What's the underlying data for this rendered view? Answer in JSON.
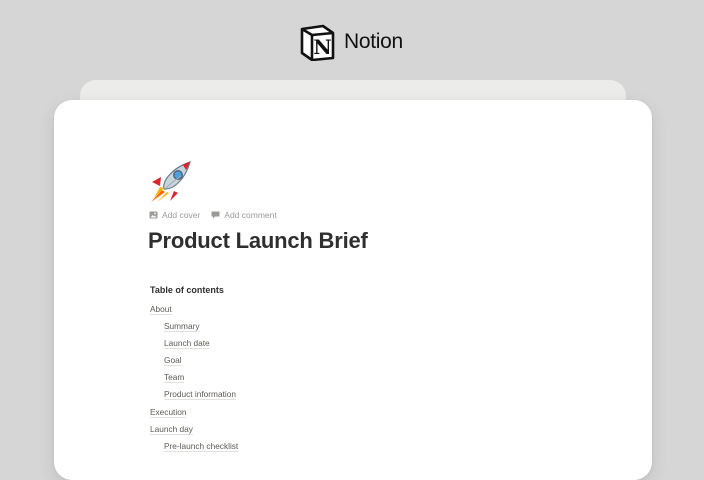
{
  "brand": {
    "name": "Notion",
    "icon": "notion-logo-icon"
  },
  "page": {
    "icon": "rocket-emoji-icon",
    "actions": [
      {
        "label": "Add cover",
        "icon": "image-icon"
      },
      {
        "label": "Add comment",
        "icon": "comment-icon"
      }
    ],
    "title": "Product Launch Brief"
  },
  "toc": {
    "heading": "Table of contents",
    "items": [
      {
        "label": "About",
        "level": 1
      },
      {
        "label": "Summary",
        "level": 2
      },
      {
        "label": "Launch date",
        "level": 2
      },
      {
        "label": "Goal",
        "level": 2
      },
      {
        "label": "Team",
        "level": 2
      },
      {
        "label": "Product information",
        "level": 2
      },
      {
        "label": "Execution",
        "level": 1
      },
      {
        "label": "Launch day",
        "level": 1
      },
      {
        "label": "Pre-launch checklist",
        "level": 2
      }
    ]
  },
  "colors": {
    "background": "#d6d6d6",
    "card": "#ffffff",
    "text": "#37352f",
    "muted": "#9b9a97"
  }
}
